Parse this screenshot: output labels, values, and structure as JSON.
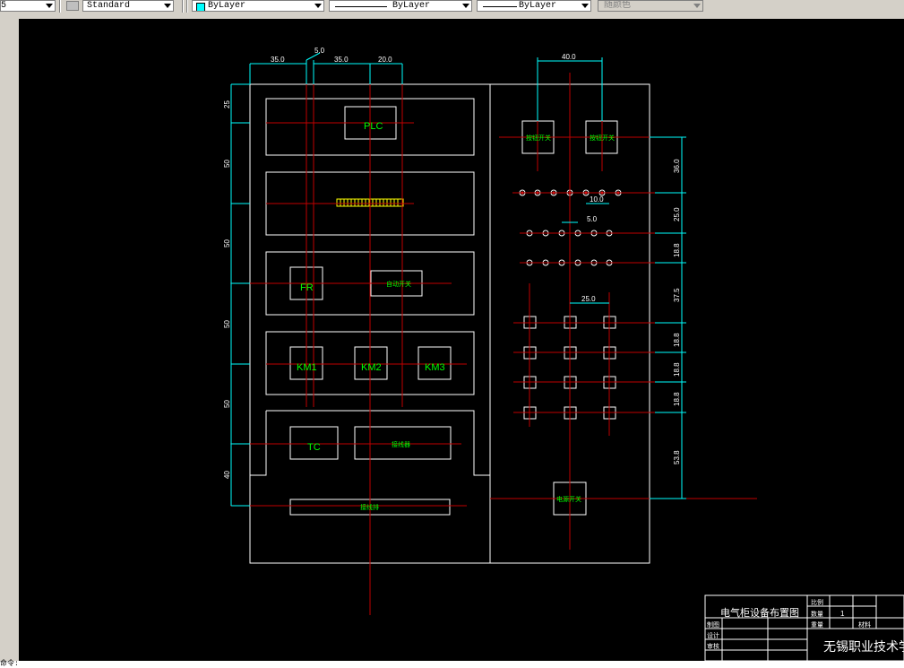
{
  "toolbar": {
    "item1": "5",
    "textstyle": "Standard",
    "layer": "ByLayer",
    "linetype": "ByLayer",
    "lineweight": "ByLayer",
    "plotstyle": "随颜色"
  },
  "dims": {
    "top_35a": "35.0",
    "top_5": "5.0",
    "top_35b": "35.0",
    "top_20": "20.0",
    "top_40": "40.0",
    "left_25": "25",
    "left_50a": "50",
    "left_50b": "50",
    "left_50c": "50",
    "left_50d": "50",
    "left_40": "40",
    "r_36": "36.0",
    "r_25": "25.0",
    "r_188a": "18.8",
    "r_375": "37.5",
    "r_188b": "18.8",
    "r_188c": "18.8",
    "r_188d": "18.8",
    "r_538": "53.8",
    "mid_10": "10.0",
    "mid_5": "5.0",
    "mid_25": "25.0"
  },
  "components": {
    "plc": "PLC",
    "fr": "FR",
    "km1": "KM1",
    "km2": "KM2",
    "km3": "KM3",
    "tc": "TC",
    "breaker": "自动开关",
    "terminal": "接线器",
    "bottom_strip": "接线排",
    "btn1": "按钮开关",
    "btn2": "按钮开关",
    "power_switch": "电源开关"
  },
  "title_block": {
    "title": "电气柜设备布置图",
    "school": "无锡职业技术学院",
    "ratio_label": "比例",
    "qty_label": "数量",
    "qty_value": "1",
    "weight_label": "重量",
    "material_label": "材料",
    "draw_label": "制图",
    "design_label": "设计",
    "review_label": "审核"
  },
  "command_line": {
    "prompt": "命令:"
  },
  "colors": {
    "frame": "#ffffff",
    "centerline": "#c00000",
    "dimension": "#00ffff",
    "annotation": "#00ff00",
    "background": "#000000"
  }
}
